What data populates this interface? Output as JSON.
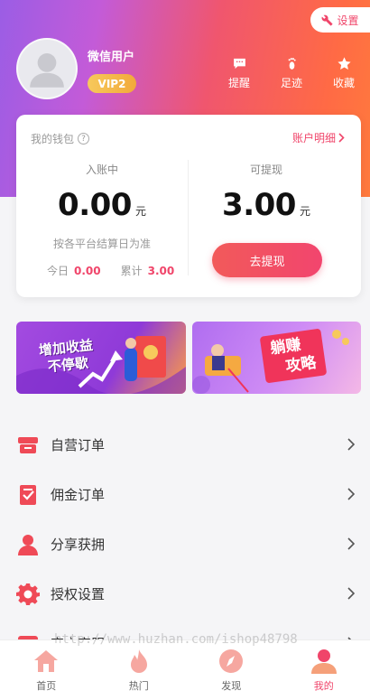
{
  "header": {
    "settings_label": "设置",
    "username": "微信用户",
    "vip_level": "VIP2",
    "actions": [
      {
        "label": "提醒",
        "icon": "message-icon"
      },
      {
        "label": "足迹",
        "icon": "footprint-icon"
      },
      {
        "label": "收藏",
        "icon": "star-icon"
      }
    ],
    "colors": {
      "gradient_start": "#9b5de5",
      "gradient_mid": "#f0566e",
      "gradient_end": "#ff7a3d"
    }
  },
  "wallet": {
    "title": "我的钱包",
    "help_icon": "?",
    "account_detail_label": "账户明细",
    "incoming": {
      "label": "入账中",
      "amount": "0.00",
      "unit": "元",
      "note": "按各平台结算日为准",
      "today_label": "今日",
      "today_value": "0.00",
      "total_label": "累计",
      "total_value": "3.00"
    },
    "withdrawable": {
      "label": "可提现",
      "amount": "3.00",
      "unit": "元",
      "button_label": "去提现"
    },
    "accent_color": "#f0456a"
  },
  "banners": [
    {
      "text_line1": "增加收益",
      "text_line2": "不停歇"
    },
    {
      "text_line1": "躺赚",
      "text_line2": "攻略"
    }
  ],
  "menu": [
    {
      "label": "自营订单",
      "icon": "shop-order-icon"
    },
    {
      "label": "佣金订单",
      "icon": "commission-order-icon"
    },
    {
      "label": "分享获拥",
      "icon": "share-user-icon"
    },
    {
      "label": "授权设置",
      "icon": "gear-icon"
    },
    {
      "label": "官方客服",
      "icon": "service-icon"
    }
  ],
  "tabbar": [
    {
      "label": "首页",
      "icon": "home-icon",
      "active": false
    },
    {
      "label": "热门",
      "icon": "fire-icon",
      "active": false
    },
    {
      "label": "发现",
      "icon": "compass-icon",
      "active": false
    },
    {
      "label": "我的",
      "icon": "user-icon",
      "active": true
    }
  ],
  "watermark": "http://www.huzhan.com/ishop48798"
}
